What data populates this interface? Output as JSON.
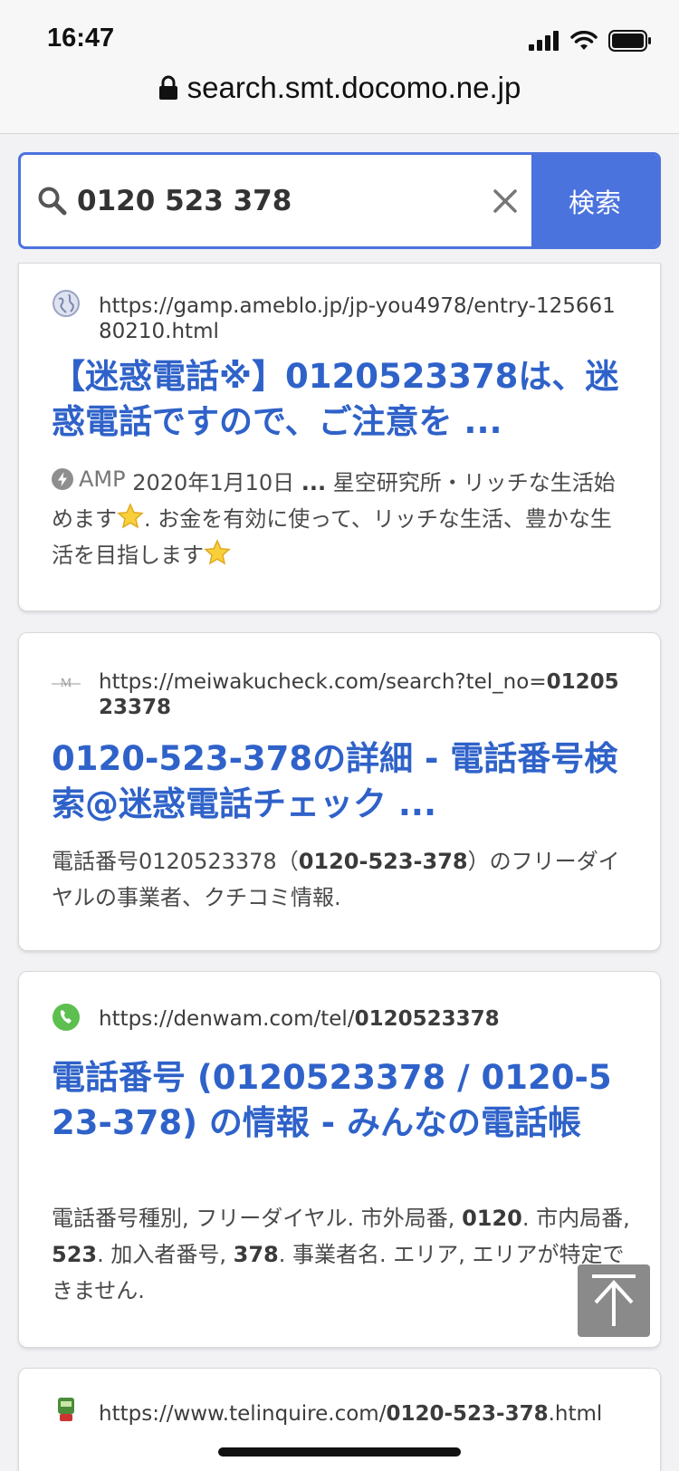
{
  "status_bar": {
    "time": "16:47"
  },
  "browser": {
    "url": "search.smt.docomo.ne.jp"
  },
  "search": {
    "query": "0120 523 378",
    "button_label": "検索"
  },
  "results": [
    {
      "url_plain": "https://gamp.ameblo.jp/jp-you4978/entry-12566180210.html",
      "title": "【迷惑電話※】0120523378は、迷惑電話ですので、ご注意を ...",
      "amp_label": "AMP",
      "date": "2020年1月10日",
      "ellipsis": "...",
      "snippet_part1": "星空研究所・リッチな生活始めます",
      "snippet_part2": ". お金を有効に使って、リッチな生活、豊かな生活を目指します"
    },
    {
      "url_plain": "https://meiwakucheck.com/search?tel_no=",
      "url_bold": "0120523378",
      "title": "0120-523-378の詳細 - 電話番号検索@迷惑電話チェック ...",
      "snippet_part1": "電話番号0120523378（",
      "snippet_bold": "0120-523-378",
      "snippet_part2": "）のフリーダイヤルの事業者、クチコミ情報."
    },
    {
      "url_plain": "https://denwam.com/tel/",
      "url_bold": "0120523378",
      "title": "電話番号 (0120523378 / 0120-523-378) の情報 - みんなの電話帳",
      "s1": "電話番号種別, フリーダイヤル. 市外局番, ",
      "b1": "0120",
      "s2": ". 市内局番, ",
      "b2": "523",
      "s3": ". 加入者番号, ",
      "b3": "378",
      "s4": ". 事業者名. エリア, エリアが特定できません."
    },
    {
      "url_plain": "https://www.telinquire.com/",
      "url_bold": "0120-523-378",
      "url_tail": ".html"
    }
  ],
  "colors": {
    "accent": "#4b73de",
    "link": "#2f62c9"
  }
}
